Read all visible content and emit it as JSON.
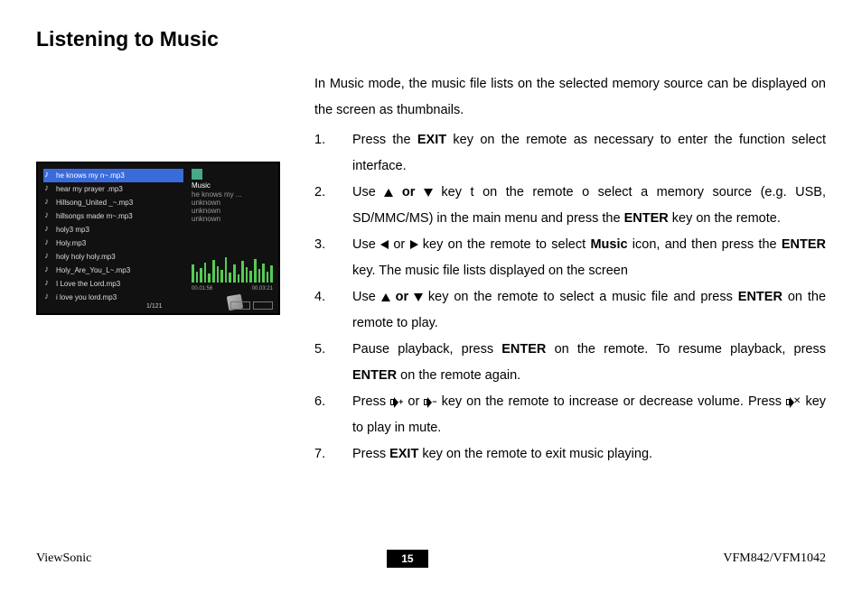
{
  "title": "Listening to Music",
  "intro": "In Music mode, the music file lists on the selected memory source can be displayed on the screen as thumbnails.",
  "steps": {
    "s1a": "Press the ",
    "s1b": "EXIT",
    "s1c": " key on the remote as necessary to enter the function select interface.",
    "s2a": "Use ",
    "s2b": " or ",
    "s2c": " key t on the remote o select a memory source (e.g. USB, SD/MMC/MS) in the main menu and press the ",
    "s2d": "ENTER",
    "s2e": " key on the remote.",
    "s3a": "Use ",
    "s3b": " or ",
    "s3c": " key on the remote to select ",
    "s3d": "Music",
    "s3e": " icon, and then press the ",
    "s3f": "ENTER",
    "s3g": " key. The music file lists displayed on the screen",
    "s4a": "Use ",
    "s4b": " or ",
    "s4c": " key on the remote to select a music file and press ",
    "s4d": "ENTER",
    "s4e": " on the remote to play.",
    "s5a": "Pause playback, press ",
    "s5b": "ENTER",
    "s5c": " on the remote. To resume playback, press ",
    "s5d": "ENTER",
    "s5e": " on the remote again.",
    "s6a": "Press ",
    "s6b": " or ",
    "s6c": " key on the remote to increase or decrease volume. Press ",
    "s6d": " key to play in mute.",
    "s7a": "Press ",
    "s7b": "EXIT",
    "s7c": " key on the remote to exit music playing."
  },
  "step_numbers": [
    "1.",
    "2.",
    "3.",
    "4.",
    "5.",
    "6.",
    "7."
  ],
  "screenshot": {
    "files": [
      "he knows my n~.mp3",
      "hear my prayer .mp3",
      "Hillsong_United _~.mp3",
      "hillsongs made m~.mp3",
      "holy3 mp3",
      "Holy.mp3",
      "holy holy holy.mp3",
      "Holy_Are_You_L~.mp3",
      "I Love the Lord.mp3",
      "i love you lord.mp3"
    ],
    "now_playing_label": "Music",
    "now_playing_title": "he knows my ...",
    "meta_lines": [
      "unknown",
      "unknown",
      "unknown"
    ],
    "time_left": "00.01:56",
    "time_right": "00.03:21",
    "counter": "1/121",
    "eq_heights": [
      20,
      12,
      16,
      22,
      10,
      25,
      18,
      14,
      28,
      11,
      20,
      9,
      24,
      17,
      13,
      26,
      15,
      21,
      12,
      19
    ]
  },
  "footer": {
    "left": "ViewSonic",
    "page": "15",
    "right": "VFM842/VFM1042"
  }
}
